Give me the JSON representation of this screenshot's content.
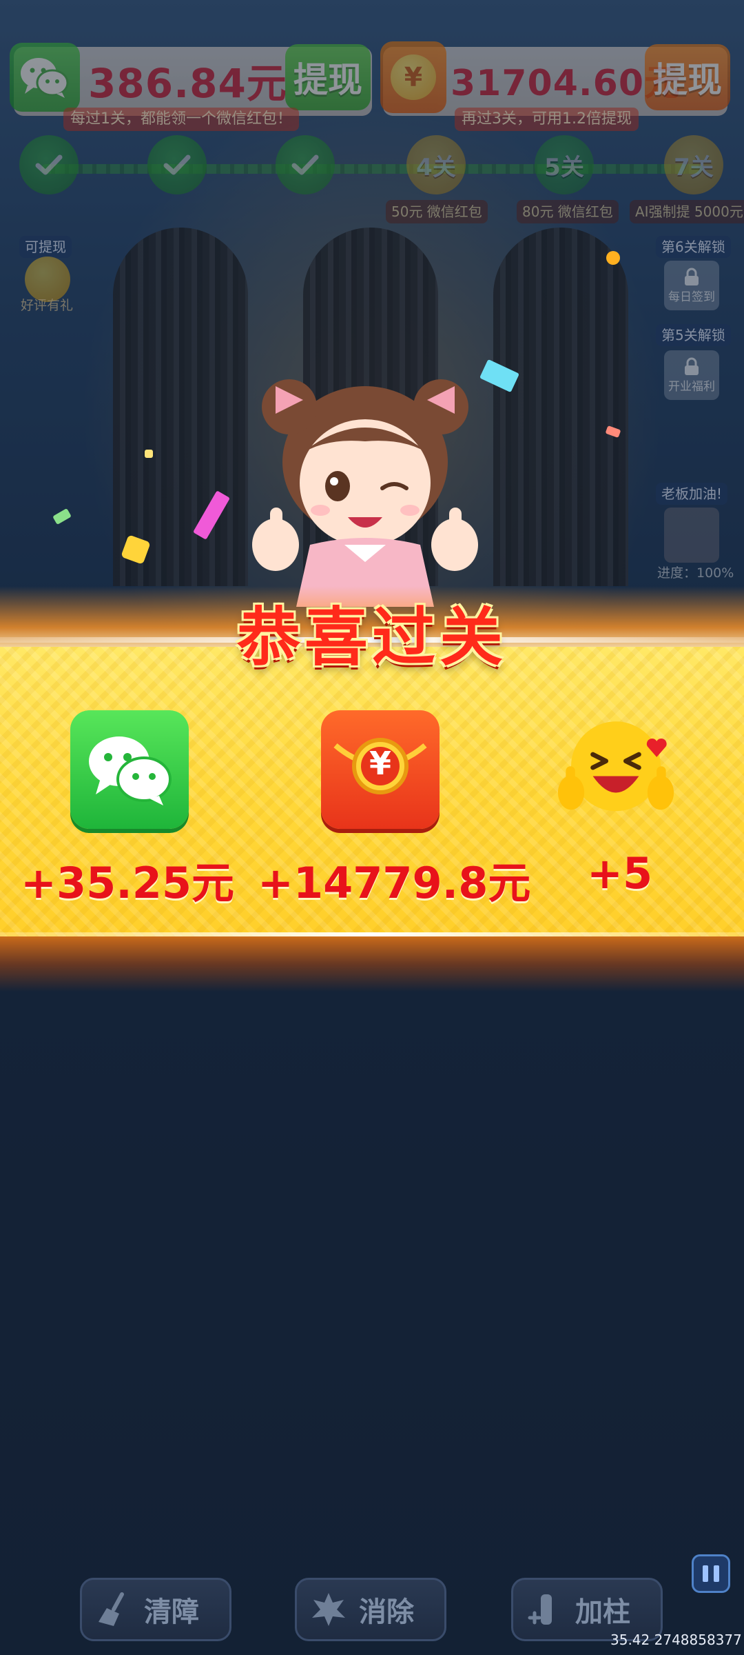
{
  "top": {
    "wechat_amount": "386.84元",
    "wechat_withdraw": "提现",
    "wechat_tip": "每过1关，都能领一个微信红包！",
    "coin_amount": "31704.60元",
    "coin_withdraw": "提现",
    "coin_tip": "再过3关，可用1.2倍提现",
    "coin_symbol": "¥"
  },
  "progress": {
    "nodes": [
      {
        "label": "",
        "state": "done"
      },
      {
        "label": "",
        "state": "done"
      },
      {
        "label": "",
        "state": "done"
      },
      {
        "label": "4关",
        "state": "todo",
        "reward": "50元 微信红包"
      },
      {
        "label": "5关",
        "state": "todo",
        "reward": "80元 微信红包"
      },
      {
        "label": "7关",
        "state": "todo",
        "reward": "AI强制提 5000元"
      }
    ]
  },
  "side": {
    "left_tag": "可提现",
    "left_caption": "好评有礼",
    "unlock6_tag": "第6关解锁",
    "unlock6_caption": "每日签到",
    "unlock5_tag": "第5关解锁",
    "unlock5_caption": "开业福利",
    "boss_tag": "老板加油!",
    "boss_progress": "进度：100%"
  },
  "result": {
    "title": "恭喜过关",
    "rewards": [
      {
        "icon": "wechat-icon",
        "value": "+35.25元"
      },
      {
        "icon": "red-packet-icon",
        "value": "+14779.8元"
      },
      {
        "icon": "emoji-thumbs-up-icon",
        "value": "+5"
      }
    ],
    "hb_symbol": "¥"
  },
  "toolbar": {
    "clear": "清障",
    "remove": "消除",
    "add_pillar": "加柱"
  },
  "footer": {
    "id_text": "35.42 2748858377"
  },
  "colors": {
    "accent_red": "#e8121a",
    "wechat_green": "#1fb53a",
    "banner_yellow": "#ffd83a"
  }
}
